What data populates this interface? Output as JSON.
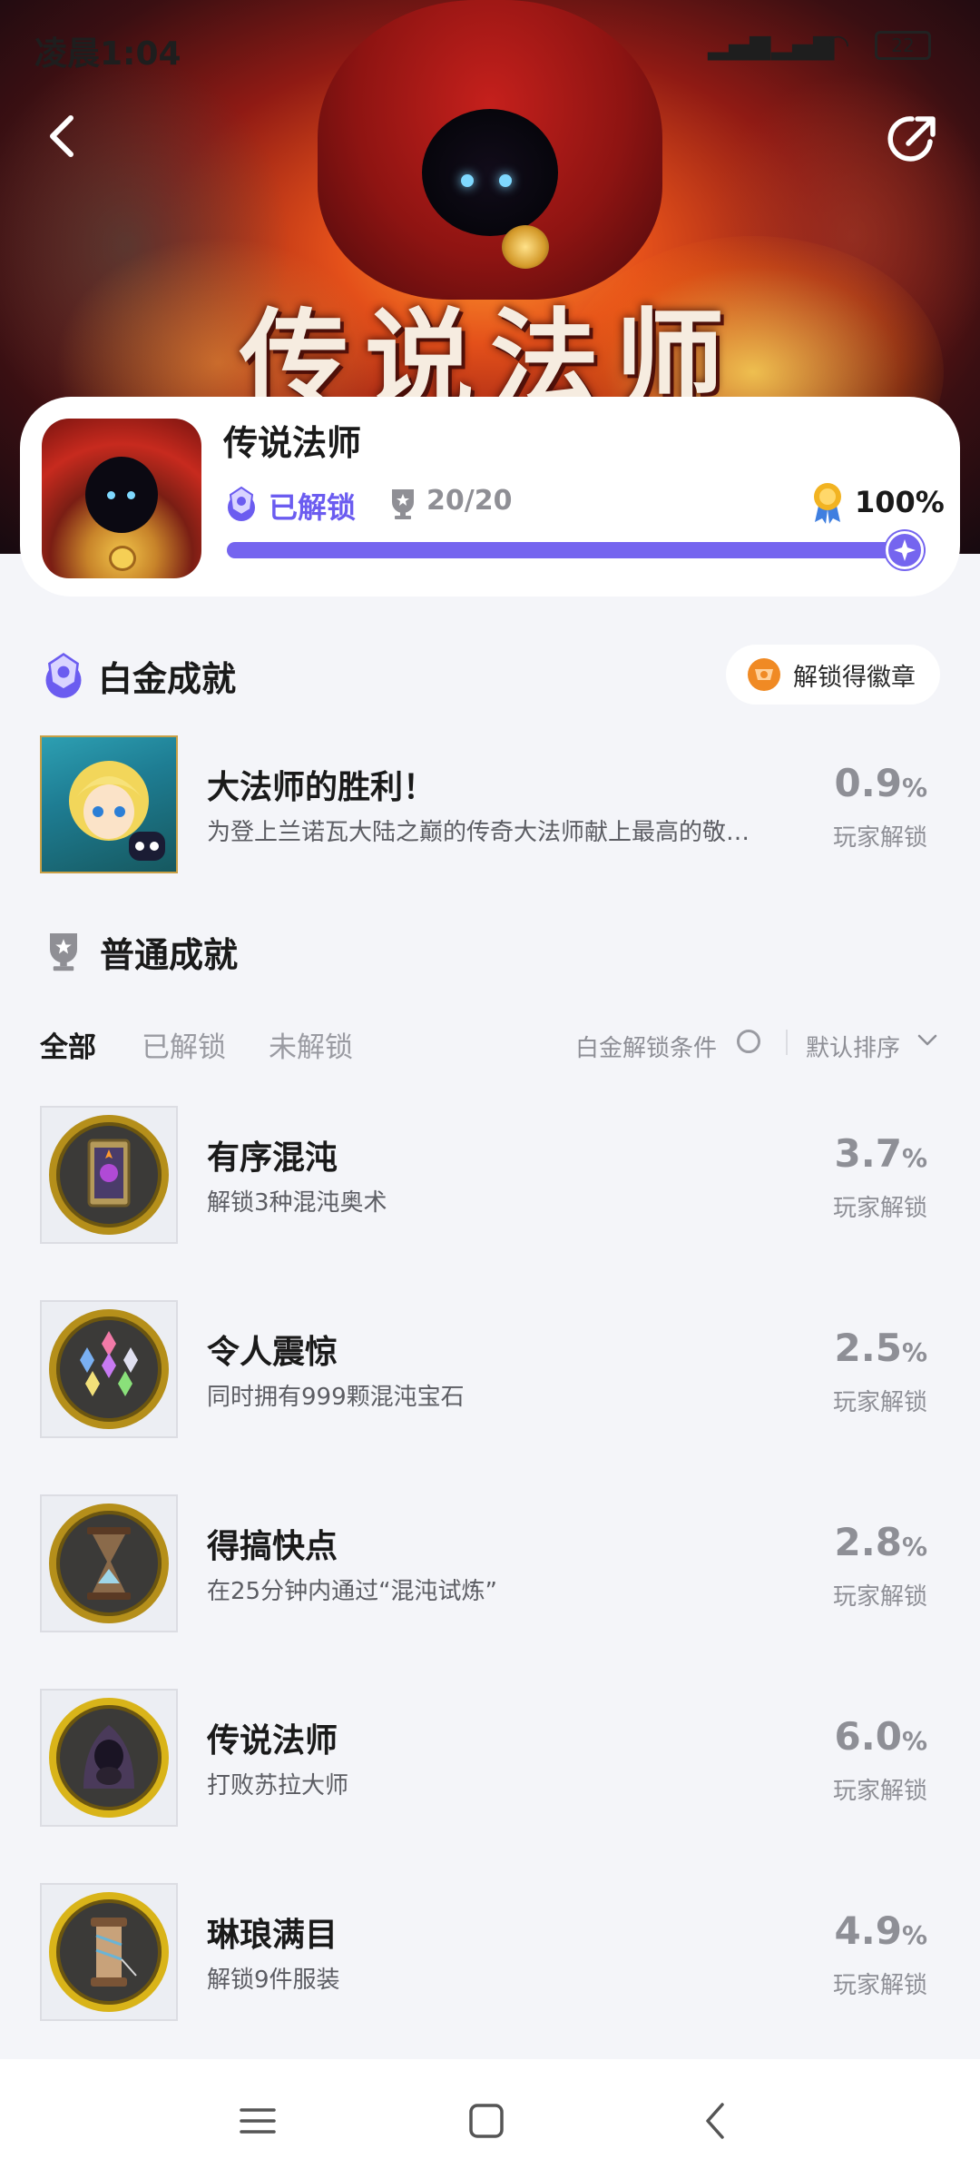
{
  "status_bar": {
    "time": "凌晨1:04",
    "battery": "22"
  },
  "header": {
    "back_label": "back",
    "share_label": "share"
  },
  "hero": {
    "art_title": "传说法师"
  },
  "game": {
    "title": "传说法师",
    "unlocked_label": "已解锁",
    "trophy_count": "20/20",
    "percent": "100%",
    "progress": 1.0
  },
  "platinum": {
    "section_title": "白金成就",
    "badge_label": "解锁得徽章",
    "item": {
      "name": "大法师的胜利！",
      "desc": "为登上兰诺瓦大陆之巅的传奇大法师献上最高的敬…",
      "rate": "0.9",
      "rate_unit": "%",
      "rate_label": "玩家解锁"
    }
  },
  "normal": {
    "section_title": "普通成就",
    "tabs": [
      "全部",
      "已解锁",
      "未解锁"
    ],
    "condition_label": "白金解锁条件",
    "sort_label": "默认排序",
    "items": [
      {
        "name": "有序混沌",
        "desc": "解锁3种混沌奥术",
        "rate": "3.7",
        "rate_unit": "%",
        "rate_label": "玩家解锁",
        "icon": "chaos-card-icon"
      },
      {
        "name": "令人震惊",
        "desc": "同时拥有999颗混沌宝石",
        "rate": "2.5",
        "rate_unit": "%",
        "rate_label": "玩家解锁",
        "icon": "gems-icon"
      },
      {
        "name": "得搞快点",
        "desc": "在25分钟内通过“混沌试炼”",
        "rate": "2.8",
        "rate_unit": "%",
        "rate_label": "玩家解锁",
        "icon": "hourglass-icon"
      },
      {
        "name": "传说法师",
        "desc": "打败苏拉大师",
        "rate": "6.0",
        "rate_unit": "%",
        "rate_label": "玩家解锁",
        "icon": "hooded-wizard-icon"
      },
      {
        "name": "琳琅满目",
        "desc": "解锁9件服装",
        "rate": "4.9",
        "rate_unit": "%",
        "rate_label": "玩家解锁",
        "icon": "thread-spool-icon"
      }
    ]
  },
  "colors": {
    "accent": "#7565ef",
    "muted": "#8e8f96",
    "background": "#f4f5f9"
  }
}
